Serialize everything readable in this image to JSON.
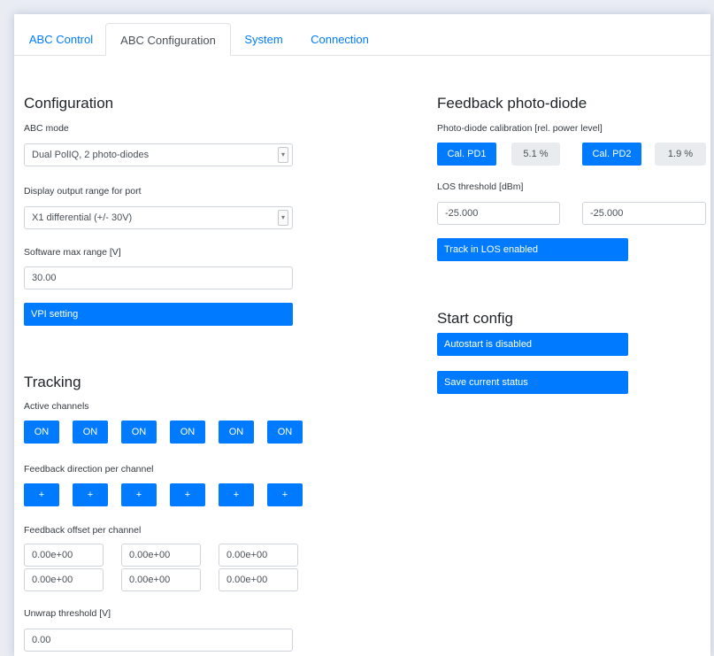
{
  "tabs": [
    {
      "label": "ABC Control"
    },
    {
      "label": "ABC Configuration"
    },
    {
      "label": "System"
    },
    {
      "label": "Connection"
    }
  ],
  "configuration": {
    "title": "Configuration",
    "abc_mode_label": "ABC mode",
    "abc_mode_value": "Dual PolIQ, 2 photo-diodes",
    "display_range_label": "Display output range for port",
    "display_range_value": "X1 differential (+/- 30V)",
    "sw_max_range_label": "Software max range [V]",
    "sw_max_range_value": "30.00",
    "vpi_button": "VPI setting"
  },
  "tracking": {
    "title": "Tracking",
    "active_channels_label": "Active channels",
    "active_channels": [
      "ON",
      "ON",
      "ON",
      "ON",
      "ON",
      "ON"
    ],
    "direction_label": "Feedback direction per channel",
    "directions": [
      "+",
      "+",
      "+",
      "+",
      "+",
      "+"
    ],
    "offset_label": "Feedback offset per channel",
    "offsets": [
      "0.00e+00",
      "0.00e+00",
      "0.00e+00",
      "0.00e+00",
      "0.00e+00",
      "0.00e+00"
    ],
    "unwrap_label": "Unwrap threshold [V]",
    "unwrap_value": "0.00"
  },
  "feedback": {
    "title": "Feedback photo-diode",
    "calibration_label": "Photo-diode calibration [rel. power level]",
    "cal_pd1_button": "Cal. PD1",
    "pd1_value": "5.1 %",
    "cal_pd2_button": "Cal. PD2",
    "pd2_value": "1.9 %",
    "los_label": "LOS threshold [dBm]",
    "los_values": [
      "-25.000",
      "-25.000"
    ],
    "track_los_button": "Track in LOS enabled"
  },
  "start_config": {
    "title": "Start config",
    "autostart_button": "Autostart is disabled",
    "save_button": "Save current status"
  },
  "colors": {
    "primary": "#007bff",
    "readonly_bg": "#e9ecef",
    "border": "#ced4da"
  }
}
